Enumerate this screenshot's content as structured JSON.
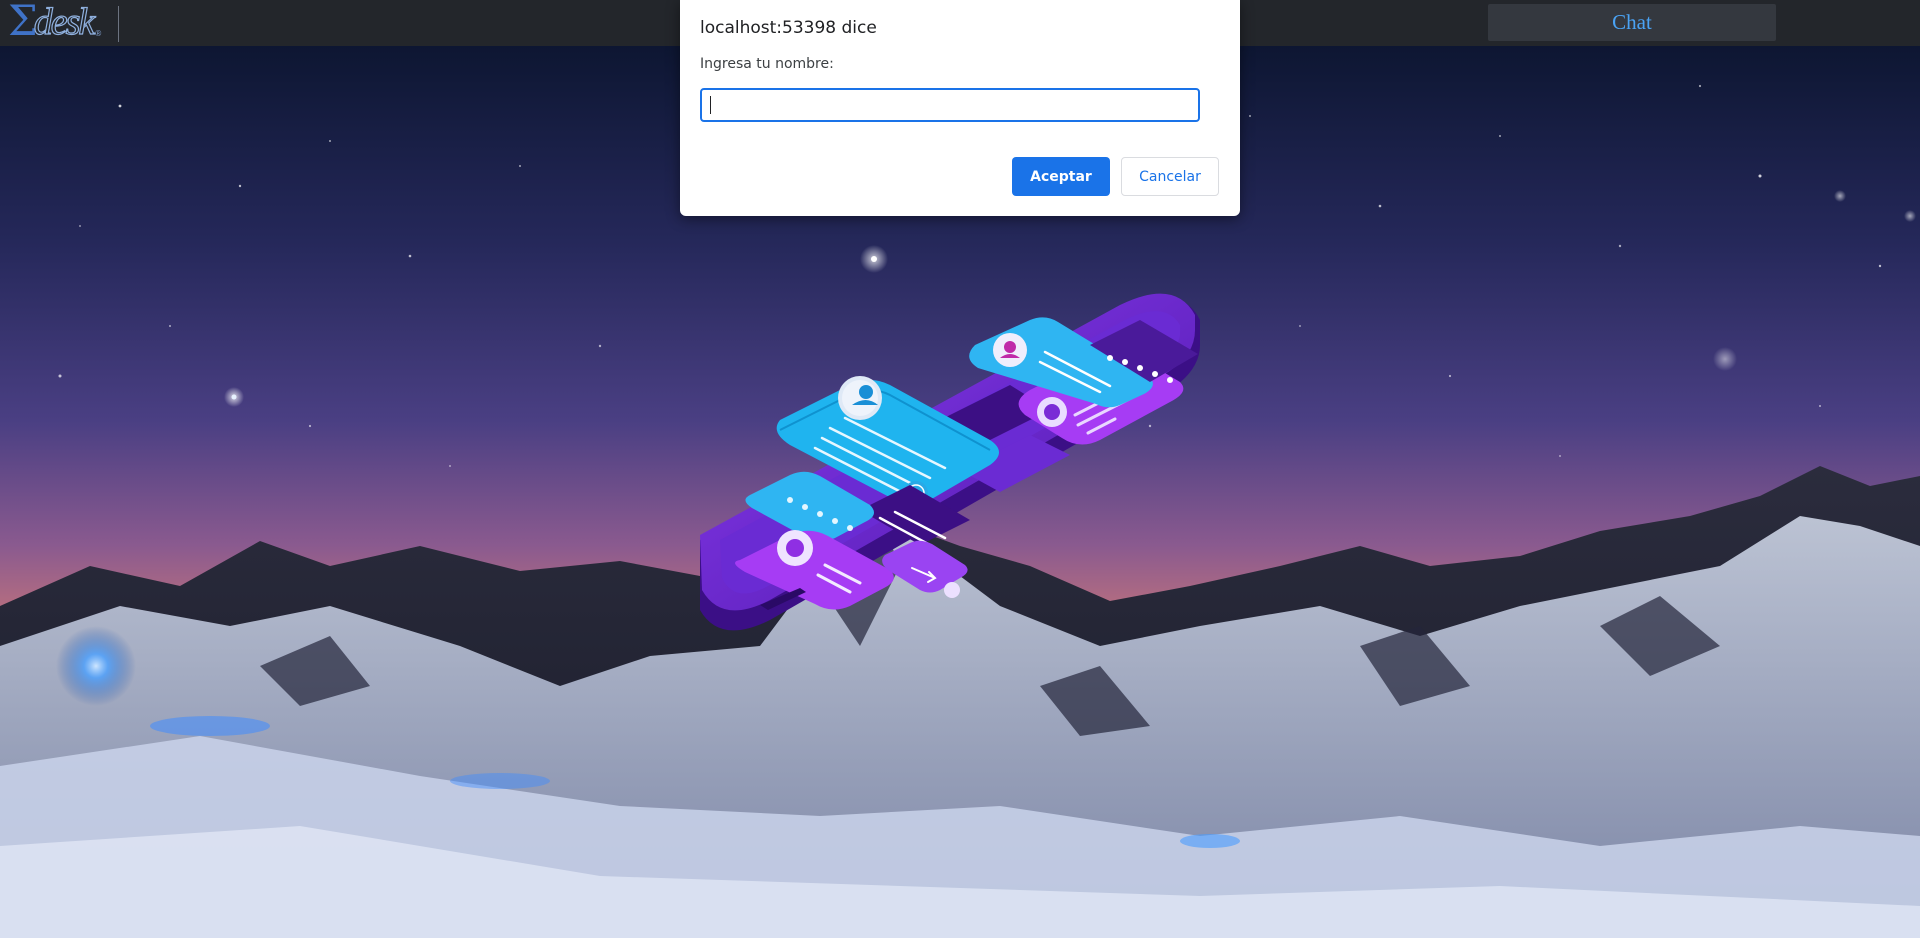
{
  "navbar": {
    "logo_sigma": "Σ",
    "logo_text": "desk",
    "logo_reg": "®",
    "chat_label": "Chat"
  },
  "dialog": {
    "title": "localhost:53398 dice",
    "message": "Ingresa tu nombre:",
    "input_value": "",
    "ok_label": "Aceptar",
    "cancel_label": "Cancelar"
  },
  "background": {
    "description_icon": "night-sky-mountain-phone-chat-illustration"
  },
  "colors": {
    "navbar_bg": "#23262b",
    "chat_button_bg": "#34383f",
    "chat_text": "#4aa3f5",
    "accent": "#1a73e8",
    "sky_top": "#0b1330",
    "sky_mid": "#3c3a7a",
    "horizon_orange": "#e58a3c",
    "phone_purple": "#6b27c9",
    "bubble_cyan": "#2ab7f5"
  }
}
